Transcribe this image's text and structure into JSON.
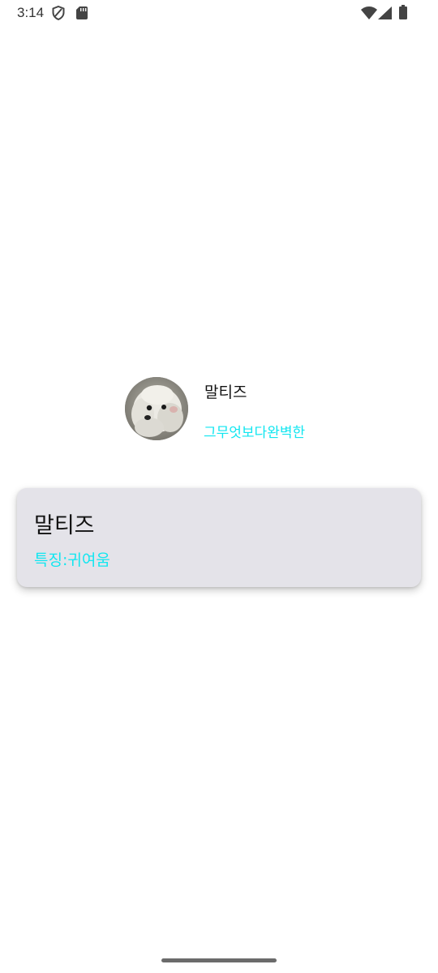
{
  "status_bar": {
    "time": "3:14",
    "icons_left": [
      "shield-icon",
      "sd-card-icon"
    ],
    "icons_right": [
      "wifi-icon",
      "cell-signal-icon",
      "battery-icon"
    ]
  },
  "profile": {
    "name": "말티즈",
    "tagline": "그무엇보다완벽한",
    "avatar_icon": "dog-photo"
  },
  "card": {
    "title": "말티즈",
    "subtitle": "특징:귀여움"
  },
  "colors": {
    "accent_cyan": "#11e6f0",
    "card_background": "#e4e3e9",
    "text_primary": "#111111"
  }
}
